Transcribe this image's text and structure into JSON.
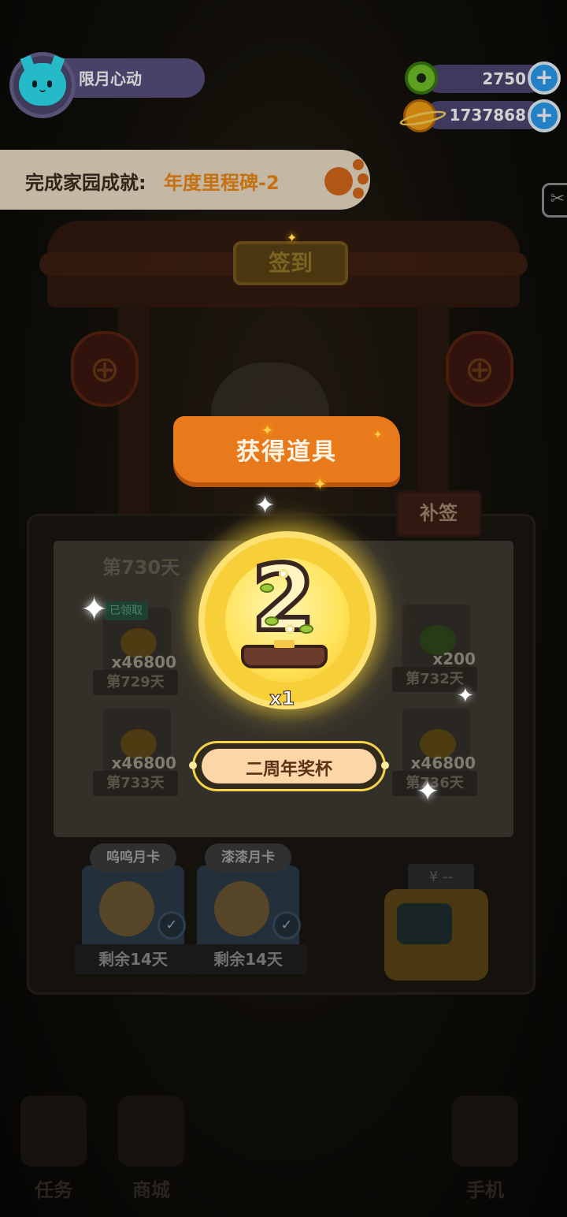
{
  "profile": {
    "name": "限月心动",
    "avatar_icon": "cat-face-icon"
  },
  "currencies": [
    {
      "icon": "donut-icon",
      "value": "2750",
      "add_label": "+"
    },
    {
      "icon": "planet-coin-icon",
      "value": "1737868",
      "add_label": "+"
    }
  ],
  "achievement": {
    "prefix": "完成家园成就:",
    "name": "年度里程碑-2",
    "icon": "paw-icon"
  },
  "background": {
    "sign_in_label": "签到",
    "makeup_label": "补签",
    "current_day": "第730天",
    "collected_tag": "已领取",
    "rewards": [
      {
        "qty": "x46800",
        "day": "第729天",
        "icon": "planet-coin-icon"
      },
      {
        "qty": "x200",
        "day": "第732天",
        "icon": "donut-icon"
      },
      {
        "qty": "x46800",
        "day": "第733天",
        "icon": "planet-coin-icon"
      },
      {
        "qty": "x46800",
        "day": "第736天",
        "icon": "planet-coin-icon"
      }
    ],
    "month_cards": [
      {
        "title": "呜呜月卡",
        "remaining": "剩余14天"
      },
      {
        "title": "漆漆月卡",
        "remaining": "剩余14天"
      }
    ],
    "robot_sign": "¥ --",
    "nav": [
      {
        "label": "任务"
      },
      {
        "label": "商城"
      },
      {
        "label": "手机"
      }
    ]
  },
  "popup": {
    "title": "获得道具",
    "item_quantity": "x1",
    "item_name": "二周年奖杯",
    "item_icon": "anniversary-trophy-icon"
  },
  "colors": {
    "accent_orange": "#e87a1c",
    "medal_gold": "#f7cf38",
    "currency_bar": "#4d4672",
    "plus_blue": "#2a9df0"
  }
}
